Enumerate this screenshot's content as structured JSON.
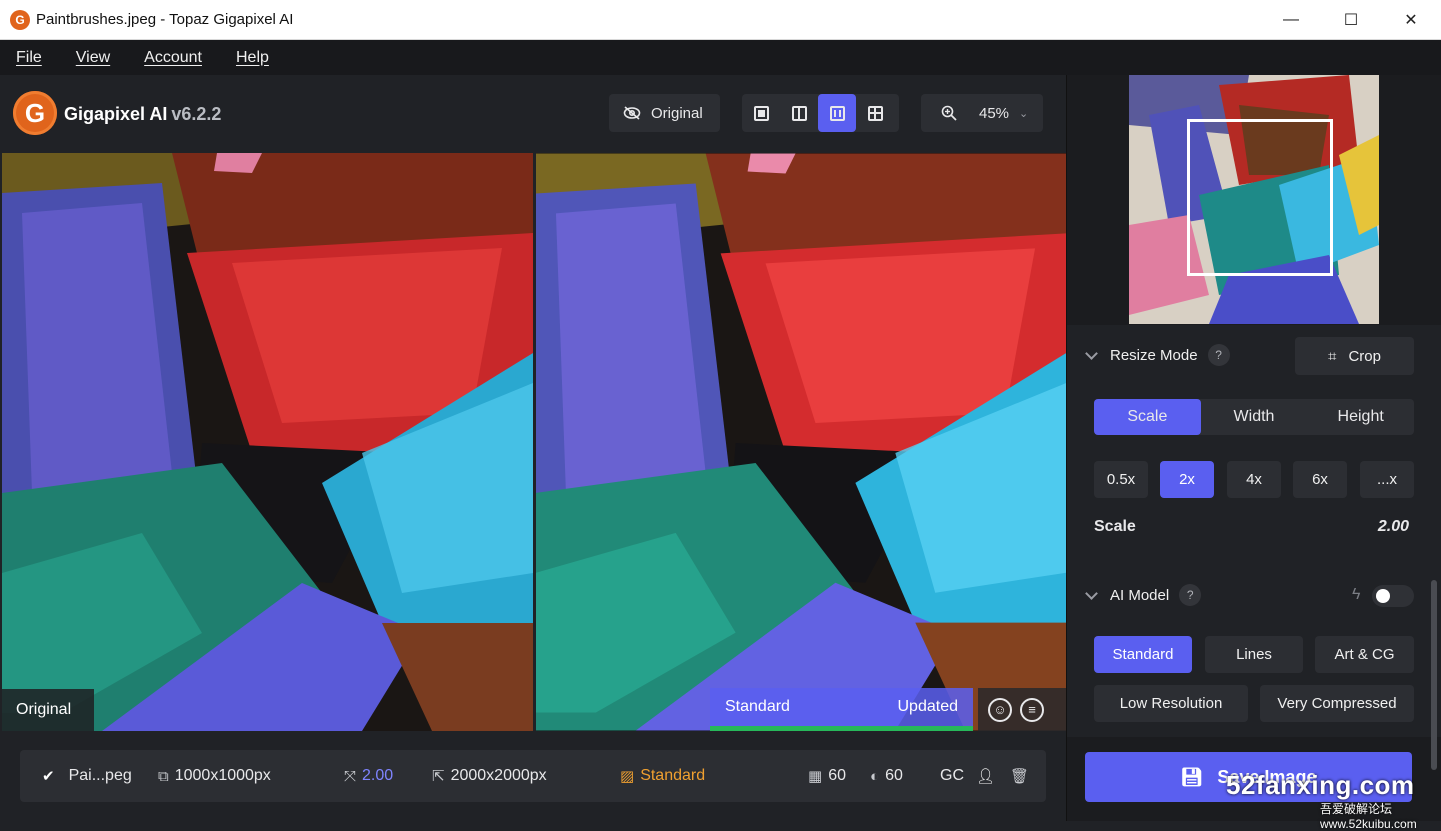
{
  "window": {
    "title": "Paintbrushes.jpeg - Topaz Gigapixel AI",
    "app_icon_letter": "G",
    "minimize": "—",
    "maximize": "☐",
    "close": "✕"
  },
  "menu": [
    "File",
    "View",
    "Account",
    "Help"
  ],
  "toolbar": {
    "logo_letter": "G",
    "brand": "Gigapixel AI",
    "version": "v6.2.2",
    "original_label": "Original",
    "zoom_value": "45%"
  },
  "preview": {
    "left_label": "Original",
    "model_name": "Standard",
    "status": "Updated"
  },
  "bottom_bar": {
    "filename": "Pai...peg",
    "input_size": "1000x1000px",
    "scale": "2.00",
    "output_size": "2000x2000px",
    "model": "Standard",
    "noise": "60",
    "blur": "60",
    "gc": "GC"
  },
  "resize": {
    "title": "Resize Mode",
    "help": "?",
    "crop_label": "Crop",
    "modes": [
      "Scale",
      "Width",
      "Height"
    ],
    "scales": [
      "0.5x",
      "2x",
      "4x",
      "6x",
      "...x"
    ],
    "scale_label": "Scale",
    "scale_value": "2.00"
  },
  "ai_model": {
    "title": "AI Model",
    "help": "?",
    "models_row1": [
      "Standard",
      "Lines",
      "Art & CG"
    ],
    "models_row2": [
      "Low Resolution",
      "Very Compressed"
    ]
  },
  "save": {
    "label": "Save Image"
  },
  "watermark": {
    "main": "52fanxing.com",
    "sub": "吾爱破解论坛 www.52kuibu.com"
  },
  "colors": {
    "accent": "#5a5ff0",
    "orange": "#e0641c",
    "model_text": "#f0a030",
    "scale_text": "#7f84ff",
    "status_green": "#27b85a"
  }
}
